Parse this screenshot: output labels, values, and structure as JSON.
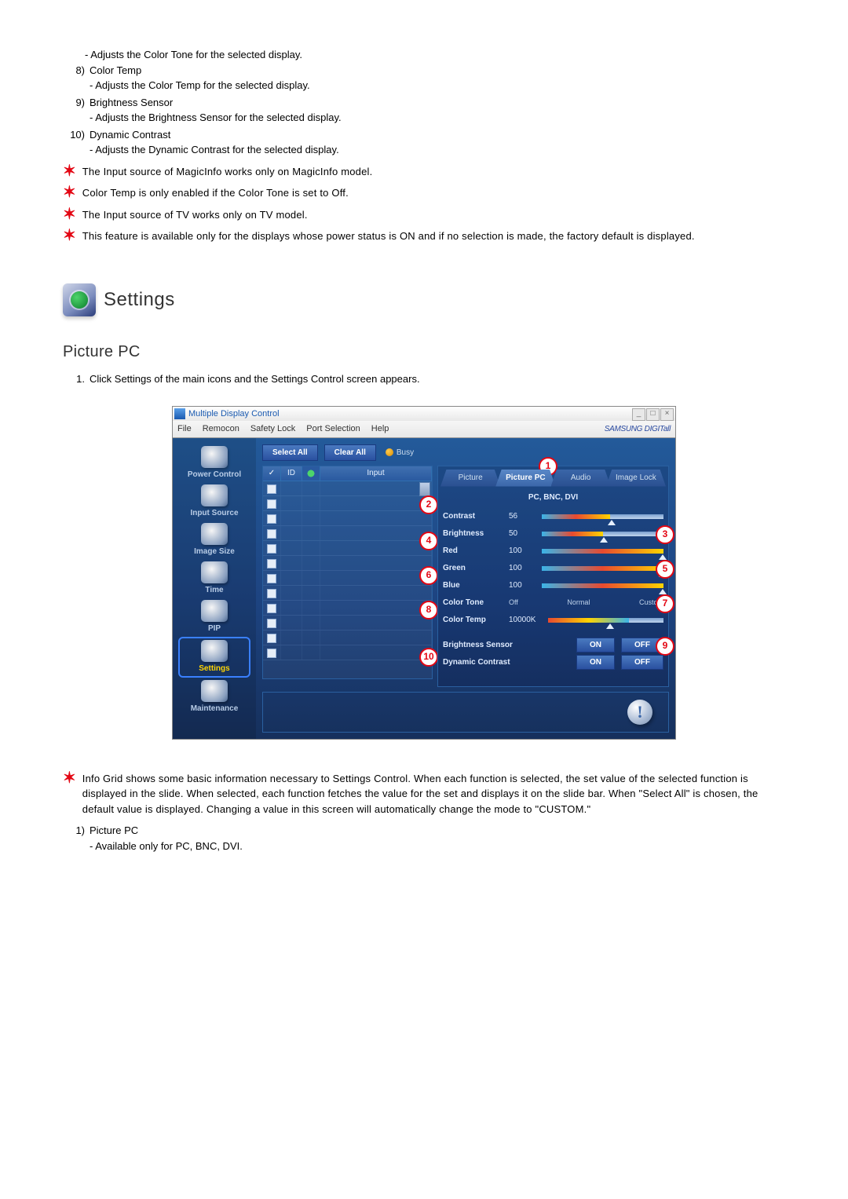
{
  "prior": {
    "item7_desc": "- Adjusts the Color Tone for the selected display.",
    "items": [
      {
        "num": "8)",
        "title": "Color Temp",
        "desc": "- Adjusts the Color Temp for the selected display."
      },
      {
        "num": "9)",
        "title": "Brightness Sensor",
        "desc": "- Adjusts the Brightness Sensor for the selected display."
      },
      {
        "num": "10)",
        "title": "Dynamic Contrast",
        "desc": "- Adjusts the Dynamic Contrast for the selected display."
      }
    ]
  },
  "notes": [
    "The Input source of MagicInfo works only on MagicInfo model.",
    "Color Temp is only enabled if the Color Tone is set to Off.",
    "The Input source of TV works only on TV model.",
    "This feature is available only for the displays whose power status is ON and if no selection is made, the factory default is displayed."
  ],
  "settings_heading": "Settings",
  "section_title": "Picture PC",
  "intro": {
    "num": "1.",
    "text": "Click Settings of the main icons and the Settings Control screen appears."
  },
  "window": {
    "title": "Multiple Display Control",
    "menus": [
      "File",
      "Remocon",
      "Safety Lock",
      "Port Selection",
      "Help"
    ],
    "brand": "SAMSUNG DIGITall",
    "sidebar": [
      {
        "label": "Power Control"
      },
      {
        "label": "Input Source"
      },
      {
        "label": "Image Size"
      },
      {
        "label": "Time"
      },
      {
        "label": "PIP"
      },
      {
        "label": "Settings",
        "selected": true
      },
      {
        "label": "Maintenance"
      }
    ],
    "buttons": {
      "select_all": "Select All",
      "clear_all": "Clear All",
      "busy": "Busy"
    },
    "grid_headers": {
      "id": "ID",
      "input": "Input"
    },
    "tabs": [
      "Picture",
      "Picture PC",
      "Audio",
      "Image Lock"
    ],
    "active_tab": 1,
    "sub_header": "PC, BNC, DVI",
    "rows": {
      "contrast": {
        "label": "Contrast",
        "value": "56"
      },
      "brightness": {
        "label": "Brightness",
        "value": "50"
      },
      "red": {
        "label": "Red",
        "value": "100"
      },
      "green": {
        "label": "Green",
        "value": "100"
      },
      "blue": {
        "label": "Blue",
        "value": "100"
      },
      "colortone": {
        "label": "Color Tone",
        "opts": [
          "Off",
          "Normal",
          "Custom"
        ]
      },
      "colortemp": {
        "label": "Color Temp",
        "value": "10000K"
      },
      "bsensor": {
        "label": "Brightness Sensor",
        "on": "ON",
        "off": "OFF"
      },
      "dcontrast": {
        "label": "Dynamic Contrast",
        "on": "ON",
        "off": "OFF"
      }
    },
    "callouts": [
      "1",
      "2",
      "3",
      "4",
      "5",
      "6",
      "7",
      "8",
      "9",
      "10"
    ]
  },
  "footer_note": "Info Grid shows some basic information necessary to Settings Control. When each function is selected, the set value of the selected function is displayed in the slide. When selected, each function fetches the value for the set and displays it on the slide bar. When \"Select All\" is chosen, the default value is displayed. Changing a value in this screen will automatically change the mode to \"CUSTOM.\"",
  "footer_item": {
    "num": "1)",
    "title": "Picture PC",
    "desc": "- Available only for PC, BNC, DVI."
  }
}
